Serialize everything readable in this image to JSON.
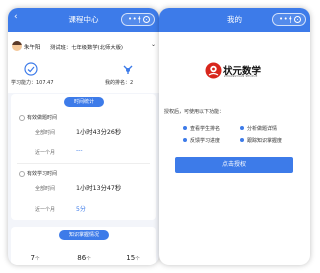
{
  "left": {
    "nav_title": "课程中心",
    "user_name": "朱午阳",
    "subject_select": "测试班：七年级数学(北师大版)",
    "ability_label": "学习能力：107.47",
    "ranking_label": "我的排名：2",
    "time_section_title": "时间统计",
    "effective_question": {
      "title": "有效做题时间",
      "total_label": "全部时间",
      "total_value": "1小时43分26秒",
      "month_label": "近一个月",
      "month_value": "---"
    },
    "effective_study": {
      "title": "有效学习时间",
      "total_label": "全部时间",
      "total_value": "1小时13分47秒",
      "month_label": "近一个月",
      "month_value": "5分"
    },
    "knowledge_section_title": "知识掌握情况",
    "stats": [
      {
        "value": "7",
        "unit": "个",
        "label": "精通"
      },
      {
        "value": "86",
        "unit": "个",
        "label": "掌握"
      },
      {
        "value": "15",
        "unit": "个",
        "label": "熟练"
      }
    ]
  },
  "right": {
    "nav_title": "我的",
    "logo_text": "状元数学",
    "logo_sub": "ZHUANGYUAN SHUXUE",
    "auth_intro": "授权后，可使用以下功能：",
    "features": [
      "查看学生排名",
      "分析做题详情",
      "反馈学习进度",
      "跟踪知识掌握度"
    ],
    "auth_button": "点击授权"
  },
  "colors": {
    "accent": "#3d7be9",
    "background": "#f3f5fa"
  }
}
